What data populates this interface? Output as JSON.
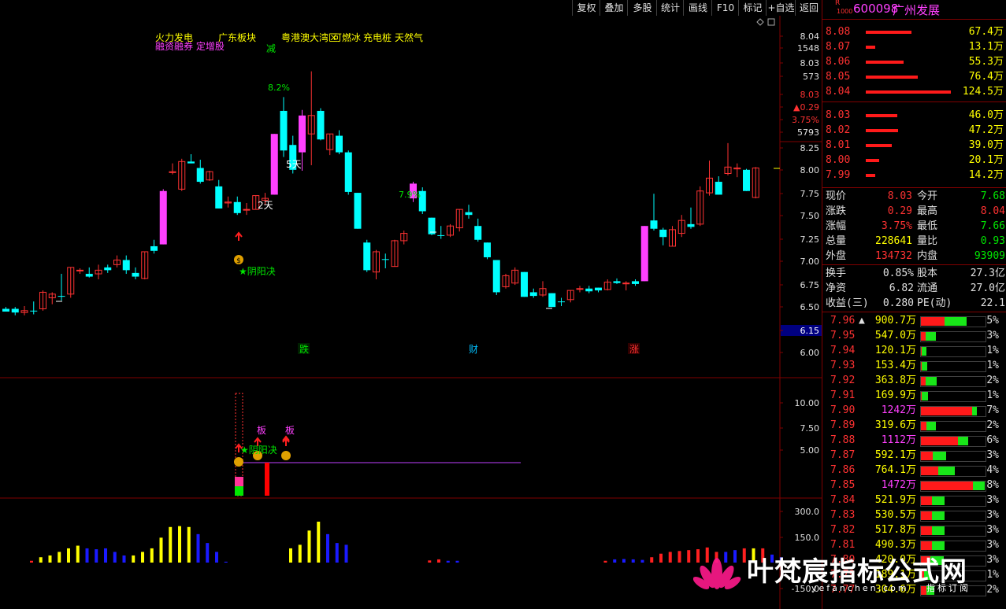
{
  "toolbar": {
    "buttons": [
      "复权",
      "叠加",
      "多股",
      "统计",
      "画线",
      "F10",
      "标记",
      "+自选",
      "返回"
    ]
  },
  "stock": {
    "badge_top": "R",
    "badge_bottom": "1000",
    "code": "600098",
    "name": "广州发展"
  },
  "chart_labels": {
    "concept_line1": [
      "火力发电",
      "广东板块",
      "粤港澳大湾区",
      "可燃冰",
      "充电桩",
      "天然气"
    ],
    "concept_line2": "融资融券 定增股",
    "reduce_label": "减",
    "pct_1": "8.2%",
    "pct_2": "7.9%",
    "days_5": "5天",
    "days_2": "2天",
    "yinyang": "★阴阳决",
    "fall": "跌",
    "wealth": "财",
    "rise": "涨",
    "ban1": "板",
    "ban2": "板",
    "sub_yinyang": "★阴阳决",
    "money_icon": "money-bag-icon"
  },
  "price_axis": {
    "ticks": [
      "8.04",
      "1548",
      "8.03",
      "573",
      "8.03",
      "▲0.29",
      "3.75%",
      "5793",
      "8.25",
      "8.00",
      "7.75",
      "7.50",
      "7.25",
      "7.00",
      "6.75",
      "6.50",
      "6.15",
      "6.00"
    ],
    "highlight_label": "6.15"
  },
  "sub_axis": {
    "ticks": [
      "10.00",
      "7.50",
      "5.00"
    ]
  },
  "vol_axis": {
    "ticks": [
      "300.0",
      "150.0",
      "-150.0"
    ]
  },
  "sell_orders": [
    {
      "price": "8.08",
      "vol": "67.4万",
      "frac": 0.54
    },
    {
      "price": "8.07",
      "vol": "13.1万",
      "frac": 0.11
    },
    {
      "price": "8.06",
      "vol": "55.3万",
      "frac": 0.44
    },
    {
      "price": "8.05",
      "vol": "76.4万",
      "frac": 0.61
    },
    {
      "price": "8.04",
      "vol": "124.5万",
      "frac": 1.0
    }
  ],
  "buy_orders": [
    {
      "price": "8.03",
      "vol": "46.0万",
      "frac": 0.37
    },
    {
      "price": "8.02",
      "vol": "47.2万",
      "frac": 0.38
    },
    {
      "price": "8.01",
      "vol": "39.0万",
      "frac": 0.31
    },
    {
      "price": "8.00",
      "vol": "20.1万",
      "frac": 0.16
    },
    {
      "price": "7.99",
      "vol": "14.2万",
      "frac": 0.11
    }
  ],
  "quote": [
    {
      "l1": "现价",
      "v1": "8.03",
      "c1": "red",
      "l2": "今开",
      "v2": "7.68",
      "c2": "green"
    },
    {
      "l1": "涨跌",
      "v1": "0.29",
      "c1": "red",
      "l2": "最高",
      "v2": "8.04",
      "c2": "red"
    },
    {
      "l1": "涨幅",
      "v1": "3.75%",
      "c1": "red",
      "l2": "最低",
      "v2": "7.66",
      "c2": "green"
    },
    {
      "l1": "总量",
      "v1": "228641",
      "c1": "yellow",
      "l2": "量比",
      "v2": "0.93",
      "c2": "green"
    },
    {
      "l1": "外盘",
      "v1": "134732",
      "c1": "red",
      "l2": "内盘",
      "v2": "93909",
      "c2": "green"
    }
  ],
  "fundamentals": [
    {
      "l1": "换手",
      "v1": "0.85%",
      "l2": "股本",
      "v2": "27.3亿"
    },
    {
      "l1": "净资",
      "v1": "6.82",
      "l2": "流通",
      "v2": "27.0亿"
    },
    {
      "l1": "收益(三)",
      "v1": "0.280",
      "l2": "PE(动)",
      "v2": "22.1"
    }
  ],
  "price_dist": [
    {
      "price": "7.96",
      "vol": "900.7万",
      "pct": "5%",
      "red": 0.38,
      "green": 0.34,
      "mark": "▲",
      "vc": "yellow"
    },
    {
      "price": "7.95",
      "vol": "547.0万",
      "pct": "3%",
      "red": 0.08,
      "green": 0.16,
      "mark": "",
      "vc": "yellow"
    },
    {
      "price": "7.94",
      "vol": "120.1万",
      "pct": "1%",
      "red": 0.02,
      "green": 0.08,
      "mark": "",
      "vc": "yellow"
    },
    {
      "price": "7.93",
      "vol": "153.4万",
      "pct": "1%",
      "red": 0.03,
      "green": 0.08,
      "mark": "",
      "vc": "yellow"
    },
    {
      "price": "7.92",
      "vol": "363.8万",
      "pct": "2%",
      "red": 0.08,
      "green": 0.18,
      "mark": "",
      "vc": "yellow"
    },
    {
      "price": "7.91",
      "vol": "169.9万",
      "pct": "1%",
      "red": 0.02,
      "green": 0.1,
      "mark": "",
      "vc": "yellow"
    },
    {
      "price": "7.90",
      "vol": "1242万",
      "pct": "7%",
      "red": 0.8,
      "green": 0.08,
      "mark": "",
      "vc": "magenta"
    },
    {
      "price": "7.89",
      "vol": "319.6万",
      "pct": "2%",
      "red": 0.1,
      "green": 0.14,
      "mark": "",
      "vc": "yellow"
    },
    {
      "price": "7.88",
      "vol": "1112万",
      "pct": "6%",
      "red": 0.58,
      "green": 0.16,
      "mark": "",
      "vc": "magenta"
    },
    {
      "price": "7.87",
      "vol": "592.1万",
      "pct": "3%",
      "red": 0.2,
      "green": 0.2,
      "mark": "",
      "vc": "yellow"
    },
    {
      "price": "7.86",
      "vol": "764.1万",
      "pct": "4%",
      "red": 0.28,
      "green": 0.26,
      "mark": "",
      "vc": "yellow"
    },
    {
      "price": "7.85",
      "vol": "1472万",
      "pct": "8%",
      "red": 0.82,
      "green": 0.18,
      "mark": "",
      "vc": "magenta"
    },
    {
      "price": "7.84",
      "vol": "521.9万",
      "pct": "3%",
      "red": 0.18,
      "green": 0.2,
      "mark": "",
      "vc": "yellow"
    },
    {
      "price": "7.83",
      "vol": "530.5万",
      "pct": "3%",
      "red": 0.18,
      "green": 0.2,
      "mark": "",
      "vc": "yellow"
    },
    {
      "price": "7.82",
      "vol": "517.8万",
      "pct": "3%",
      "red": 0.18,
      "green": 0.2,
      "mark": "",
      "vc": "yellow"
    },
    {
      "price": "7.81",
      "vol": "490.3万",
      "pct": "3%",
      "red": 0.18,
      "green": 0.2,
      "mark": "",
      "vc": "yellow"
    },
    {
      "price": "7.80",
      "vol": "420.0万",
      "pct": "3%",
      "red": 0.16,
      "green": 0.2,
      "mark": "",
      "vc": "yellow"
    },
    {
      "price": "7.79",
      "vol": "189.1万",
      "pct": "1%",
      "red": 0.06,
      "green": 0.1,
      "mark": "",
      "vc": "yellow"
    },
    {
      "price": "7.77",
      "vol": "304.6万",
      "pct": "2%",
      "red": 0.1,
      "green": 0.12,
      "mark": "",
      "vc": "yellow"
    }
  ],
  "watermark": {
    "title": "叶梵宸指标公式网",
    "url": "yefanchen.com",
    "sub": "指标订阅"
  },
  "candles": [
    {
      "o": 6.5,
      "h": 6.52,
      "l": 6.47,
      "c": 6.47,
      "d": "dn"
    },
    {
      "o": 6.46,
      "h": 6.52,
      "l": 6.43,
      "c": 6.5,
      "d": "dn"
    },
    {
      "o": 6.46,
      "h": 6.53,
      "l": 6.43,
      "c": 6.48,
      "d": "up"
    },
    {
      "o": 6.48,
      "h": 6.58,
      "l": 6.44,
      "c": 6.48,
      "d": "dn"
    },
    {
      "o": 6.5,
      "h": 6.7,
      "l": 6.48,
      "c": 6.68,
      "d": "up"
    },
    {
      "o": 6.62,
      "h": 6.68,
      "l": 6.55,
      "c": 6.66,
      "d": "up"
    },
    {
      "o": 6.64,
      "h": 6.88,
      "l": 6.59,
      "c": 6.64,
      "d": "dn"
    },
    {
      "o": 6.66,
      "h": 6.95,
      "l": 6.62,
      "c": 6.95,
      "d": "up"
    },
    {
      "o": 6.92,
      "h": 6.94,
      "l": 6.88,
      "c": 6.92,
      "d": "up"
    },
    {
      "o": 6.88,
      "h": 6.95,
      "l": 6.84,
      "c": 6.85,
      "d": "dn"
    },
    {
      "o": 6.88,
      "h": 6.98,
      "l": 6.82,
      "c": 6.92,
      "d": "up"
    },
    {
      "o": 6.92,
      "h": 6.98,
      "l": 6.89,
      "c": 6.95,
      "d": "dn"
    },
    {
      "o": 6.98,
      "h": 7.08,
      "l": 6.95,
      "c": 7.03,
      "d": "up"
    },
    {
      "o": 7.03,
      "h": 7.08,
      "l": 6.88,
      "c": 6.92,
      "d": "dn"
    },
    {
      "o": 6.89,
      "h": 6.95,
      "l": 6.82,
      "c": 6.85,
      "d": "dn"
    },
    {
      "o": 6.83,
      "h": 7.12,
      "l": 6.82,
      "c": 7.12,
      "d": "up"
    },
    {
      "o": 7.18,
      "h": 7.25,
      "l": 7.1,
      "c": 7.13,
      "d": "dn"
    },
    {
      "o": 7.2,
      "h": 7.8,
      "l": 7.2,
      "c": 7.78,
      "d": "lim"
    },
    {
      "o": 7.99,
      "h": 8.08,
      "l": 7.96,
      "c": 7.98,
      "d": "up"
    },
    {
      "o": 7.8,
      "h": 8.13,
      "l": 7.78,
      "c": 8.1,
      "d": "up"
    },
    {
      "o": 8.1,
      "h": 8.18,
      "l": 8.08,
      "c": 8.08,
      "d": "dn"
    },
    {
      "o": 8.03,
      "h": 8.12,
      "l": 7.86,
      "c": 7.88,
      "d": "dn"
    },
    {
      "o": 7.99,
      "h": 8.0,
      "l": 7.89,
      "c": 7.9,
      "d": "up"
    },
    {
      "o": 7.83,
      "h": 7.9,
      "l": 7.59,
      "c": 7.59,
      "d": "dn"
    },
    {
      "o": 7.66,
      "h": 7.72,
      "l": 7.6,
      "c": 7.65,
      "d": "up"
    },
    {
      "o": 7.54,
      "h": 7.72,
      "l": 7.52,
      "c": 7.66,
      "d": "dn"
    },
    {
      "o": 7.58,
      "h": 7.65,
      "l": 7.52,
      "c": 7.58,
      "d": "up"
    },
    {
      "o": 7.58,
      "h": 7.73,
      "l": 7.58,
      "c": 7.73,
      "d": "up"
    },
    {
      "o": 7.68,
      "h": 7.76,
      "l": 7.63,
      "c": 7.7,
      "d": "up"
    },
    {
      "o": 7.74,
      "h": 8.4,
      "l": 7.74,
      "c": 8.4,
      "d": "lim"
    },
    {
      "o": 8.65,
      "h": 8.8,
      "l": 8.15,
      "c": 8.22,
      "d": "dn"
    },
    {
      "o": 8.28,
      "h": 8.38,
      "l": 7.97,
      "c": 8.01,
      "d": "dn"
    },
    {
      "o": 8.2,
      "h": 8.66,
      "l": 8.0,
      "c": 8.6,
      "d": "lim"
    },
    {
      "o": 8.6,
      "h": 9.08,
      "l": 8.06,
      "c": 8.4,
      "d": "up"
    },
    {
      "o": 8.65,
      "h": 8.68,
      "l": 8.33,
      "c": 8.34,
      "d": "dn"
    },
    {
      "o": 8.23,
      "h": 8.4,
      "l": 8.17,
      "c": 8.4,
      "d": "up"
    },
    {
      "o": 8.38,
      "h": 8.44,
      "l": 8.18,
      "c": 8.2,
      "d": "dn"
    },
    {
      "o": 8.2,
      "h": 8.22,
      "l": 7.74,
      "c": 7.77,
      "d": "dn"
    },
    {
      "o": 7.76,
      "h": 7.76,
      "l": 7.37,
      "c": 7.37,
      "d": "dn"
    },
    {
      "o": 7.22,
      "h": 7.25,
      "l": 6.9,
      "c": 6.92,
      "d": "dn"
    },
    {
      "o": 6.9,
      "h": 7.14,
      "l": 6.82,
      "c": 7.12,
      "d": "up"
    },
    {
      "o": 7.04,
      "h": 7.1,
      "l": 6.94,
      "c": 7.04,
      "d": "dn"
    },
    {
      "o": 6.96,
      "h": 7.25,
      "l": 6.96,
      "c": 7.24,
      "d": "up"
    },
    {
      "o": 7.24,
      "h": 7.35,
      "l": 7.2,
      "c": 7.32,
      "d": "up"
    },
    {
      "o": 7.7,
      "h": 7.88,
      "l": 7.66,
      "c": 7.86,
      "d": "lim"
    },
    {
      "o": 7.78,
      "h": 7.82,
      "l": 7.53,
      "c": 7.56,
      "d": "dn"
    },
    {
      "o": 7.49,
      "h": 7.49,
      "l": 7.3,
      "c": 7.31,
      "d": "dn"
    },
    {
      "o": 7.3,
      "h": 7.4,
      "l": 7.26,
      "c": 7.3,
      "d": "dn"
    },
    {
      "o": 7.3,
      "h": 7.42,
      "l": 7.28,
      "c": 7.4,
      "d": "up"
    },
    {
      "o": 7.38,
      "h": 7.58,
      "l": 7.34,
      "c": 7.58,
      "d": "up"
    },
    {
      "o": 7.55,
      "h": 7.63,
      "l": 7.48,
      "c": 7.52,
      "d": "dn"
    },
    {
      "o": 7.4,
      "h": 7.48,
      "l": 7.23,
      "c": 7.25,
      "d": "dn"
    },
    {
      "o": 7.22,
      "h": 7.22,
      "l": 7.04,
      "c": 7.06,
      "d": "dn"
    },
    {
      "o": 7.03,
      "h": 7.03,
      "l": 6.65,
      "c": 6.68,
      "d": "dn"
    },
    {
      "o": 6.74,
      "h": 6.88,
      "l": 6.72,
      "c": 6.86,
      "d": "up"
    },
    {
      "o": 6.78,
      "h": 6.95,
      "l": 6.76,
      "c": 6.92,
      "d": "up"
    },
    {
      "o": 6.9,
      "h": 6.9,
      "l": 6.63,
      "c": 6.63,
      "d": "dn"
    },
    {
      "o": 6.68,
      "h": 6.72,
      "l": 6.62,
      "c": 6.64,
      "d": "dn"
    },
    {
      "o": 6.72,
      "h": 6.8,
      "l": 6.63,
      "c": 6.65,
      "d": "up"
    },
    {
      "o": 6.67,
      "h": 6.67,
      "l": 6.52,
      "c": 6.52,
      "d": "dn"
    },
    {
      "o": 6.58,
      "h": 6.62,
      "l": 6.53,
      "c": 6.58,
      "d": "dn"
    },
    {
      "o": 6.6,
      "h": 6.7,
      "l": 6.57,
      "c": 6.7,
      "d": "up"
    },
    {
      "o": 6.72,
      "h": 6.75,
      "l": 6.68,
      "c": 6.72,
      "d": "up"
    },
    {
      "o": 6.72,
      "h": 6.75,
      "l": 6.67,
      "c": 6.69,
      "d": "dn"
    },
    {
      "o": 6.73,
      "h": 6.73,
      "l": 6.68,
      "c": 6.7,
      "d": "dn"
    },
    {
      "o": 6.71,
      "h": 6.82,
      "l": 6.7,
      "c": 6.79,
      "d": "up"
    },
    {
      "o": 6.8,
      "h": 6.83,
      "l": 6.77,
      "c": 6.78,
      "d": "dn"
    },
    {
      "o": 6.78,
      "h": 6.8,
      "l": 6.7,
      "c": 6.78,
      "d": "up"
    },
    {
      "o": 6.8,
      "h": 6.82,
      "l": 6.75,
      "c": 6.77,
      "d": "dn"
    },
    {
      "o": 6.8,
      "h": 7.4,
      "l": 6.8,
      "c": 7.4,
      "d": "lim"
    },
    {
      "o": 7.46,
      "h": 7.75,
      "l": 7.35,
      "c": 7.37,
      "d": "dn"
    },
    {
      "o": 7.36,
      "h": 7.38,
      "l": 7.19,
      "c": 7.28,
      "d": "dn"
    },
    {
      "o": 7.18,
      "h": 7.4,
      "l": 7.18,
      "c": 7.36,
      "d": "up"
    },
    {
      "o": 7.32,
      "h": 7.52,
      "l": 7.28,
      "c": 7.46,
      "d": "up"
    },
    {
      "o": 7.42,
      "h": 7.6,
      "l": 7.37,
      "c": 7.39,
      "d": "dn"
    },
    {
      "o": 7.42,
      "h": 7.83,
      "l": 7.4,
      "c": 7.78,
      "d": "up"
    },
    {
      "o": 7.76,
      "h": 8.11,
      "l": 7.73,
      "c": 7.92,
      "d": "up"
    },
    {
      "o": 7.88,
      "h": 7.94,
      "l": 7.74,
      "c": 7.74,
      "d": "dn"
    },
    {
      "o": 7.97,
      "h": 8.3,
      "l": 7.95,
      "c": 8.04,
      "d": "up"
    },
    {
      "o": 8.02,
      "h": 8.08,
      "l": 7.93,
      "c": 8.03,
      "d": "up"
    },
    {
      "o": 8.01,
      "h": 8.02,
      "l": 7.78,
      "c": 7.78,
      "d": "dn"
    },
    {
      "o": 7.71,
      "h": 8.04,
      "l": 7.7,
      "c": 8.03,
      "d": "up"
    }
  ],
  "volume_bars": [
    {
      "v": 10,
      "c": "#ff2020"
    },
    {
      "v": 30,
      "c": "#ffff00"
    },
    {
      "v": 40,
      "c": "#ffff00"
    },
    {
      "v": 60,
      "c": "#ffff00"
    },
    {
      "v": 80,
      "c": "#ffff00"
    },
    {
      "v": 95,
      "c": "#ffff00"
    },
    {
      "v": 80,
      "c": "#1a1aff"
    },
    {
      "v": 75,
      "c": "#1a1aff"
    },
    {
      "v": 80,
      "c": "#1a1aff"
    },
    {
      "v": 60,
      "c": "#1a1aff"
    },
    {
      "v": 40,
      "c": "#1a1aff"
    },
    {
      "v": 40,
      "c": "#ffff00"
    },
    {
      "v": 60,
      "c": "#ffff00"
    },
    {
      "v": 80,
      "c": "#ffff00"
    },
    {
      "v": 140,
      "c": "#ffff00"
    },
    {
      "v": 200,
      "c": "#ffff00"
    },
    {
      "v": 205,
      "c": "#ffff00"
    },
    {
      "v": 200,
      "c": "#ffff00"
    },
    {
      "v": 160,
      "c": "#1a1aff"
    },
    {
      "v": 110,
      "c": "#1a1aff"
    },
    {
      "v": 60,
      "c": "#1a1aff"
    },
    {
      "v": 5,
      "c": "#1a1aff"
    },
    {
      "v": 0,
      "c": "#000"
    },
    {
      "v": 0,
      "c": "#000"
    },
    {
      "v": 0,
      "c": "#000"
    },
    {
      "v": 0,
      "c": "#000"
    },
    {
      "v": 0,
      "c": "#000"
    },
    {
      "v": 0,
      "c": "#000"
    },
    {
      "v": 80,
      "c": "#ffff00"
    },
    {
      "v": 100,
      "c": "#ffff00"
    },
    {
      "v": 180,
      "c": "#ffff00"
    },
    {
      "v": 230,
      "c": "#ffff00"
    },
    {
      "v": 160,
      "c": "#1a1aff"
    },
    {
      "v": 110,
      "c": "#1a1aff"
    },
    {
      "v": 100,
      "c": "#1a1aff"
    },
    {
      "v": 0,
      "c": "#000"
    },
    {
      "v": 0,
      "c": "#000"
    },
    {
      "v": 0,
      "c": "#000"
    },
    {
      "v": 0,
      "c": "#000"
    },
    {
      "v": 0,
      "c": "#000"
    },
    {
      "v": 0,
      "c": "#000"
    },
    {
      "v": 0,
      "c": "#000"
    },
    {
      "v": 0,
      "c": "#000"
    },
    {
      "v": 12,
      "c": "#ff2020"
    },
    {
      "v": 18,
      "c": "#ff2020"
    },
    {
      "v": 10,
      "c": "#1a1aff"
    },
    {
      "v": 10,
      "c": "#1a1aff"
    },
    {
      "v": 0,
      "c": "#000"
    },
    {
      "v": 0,
      "c": "#000"
    },
    {
      "v": 0,
      "c": "#000"
    },
    {
      "v": 0,
      "c": "#000"
    },
    {
      "v": 0,
      "c": "#000"
    },
    {
      "v": 0,
      "c": "#000"
    },
    {
      "v": 0,
      "c": "#000"
    },
    {
      "v": 0,
      "c": "#000"
    },
    {
      "v": 0,
      "c": "#000"
    },
    {
      "v": 0,
      "c": "#000"
    },
    {
      "v": 0,
      "c": "#000"
    },
    {
      "v": 0,
      "c": "#000"
    },
    {
      "v": 0,
      "c": "#000"
    },
    {
      "v": 0,
      "c": "#000"
    },
    {
      "v": 0,
      "c": "#000"
    },
    {
      "v": 10,
      "c": "#ff2020"
    },
    {
      "v": 18,
      "c": "#1a1aff"
    },
    {
      "v": 20,
      "c": "#1a1aff"
    },
    {
      "v": 18,
      "c": "#1a1aff"
    },
    {
      "v": 15,
      "c": "#1a1aff"
    },
    {
      "v": 30,
      "c": "#ff2020"
    },
    {
      "v": 50,
      "c": "#ff2020"
    },
    {
      "v": 60,
      "c": "#ff2020"
    },
    {
      "v": 65,
      "c": "#ff2020"
    },
    {
      "v": 70,
      "c": "#ff2020"
    },
    {
      "v": 75,
      "c": "#ff2020"
    },
    {
      "v": 85,
      "c": "#ff2020"
    },
    {
      "v": 60,
      "c": "#ff2020"
    },
    {
      "v": 60,
      "c": "#1a1aff"
    },
    {
      "v": 70,
      "c": "#1a1aff"
    },
    {
      "v": 80,
      "c": "#ff2020"
    },
    {
      "v": 80,
      "c": "#ffff00"
    },
    {
      "v": 80,
      "c": "#ff2020"
    },
    {
      "v": 45,
      "c": "#1a1aff"
    },
    {
      "v": 30,
      "c": "#1a1aff"
    }
  ]
}
